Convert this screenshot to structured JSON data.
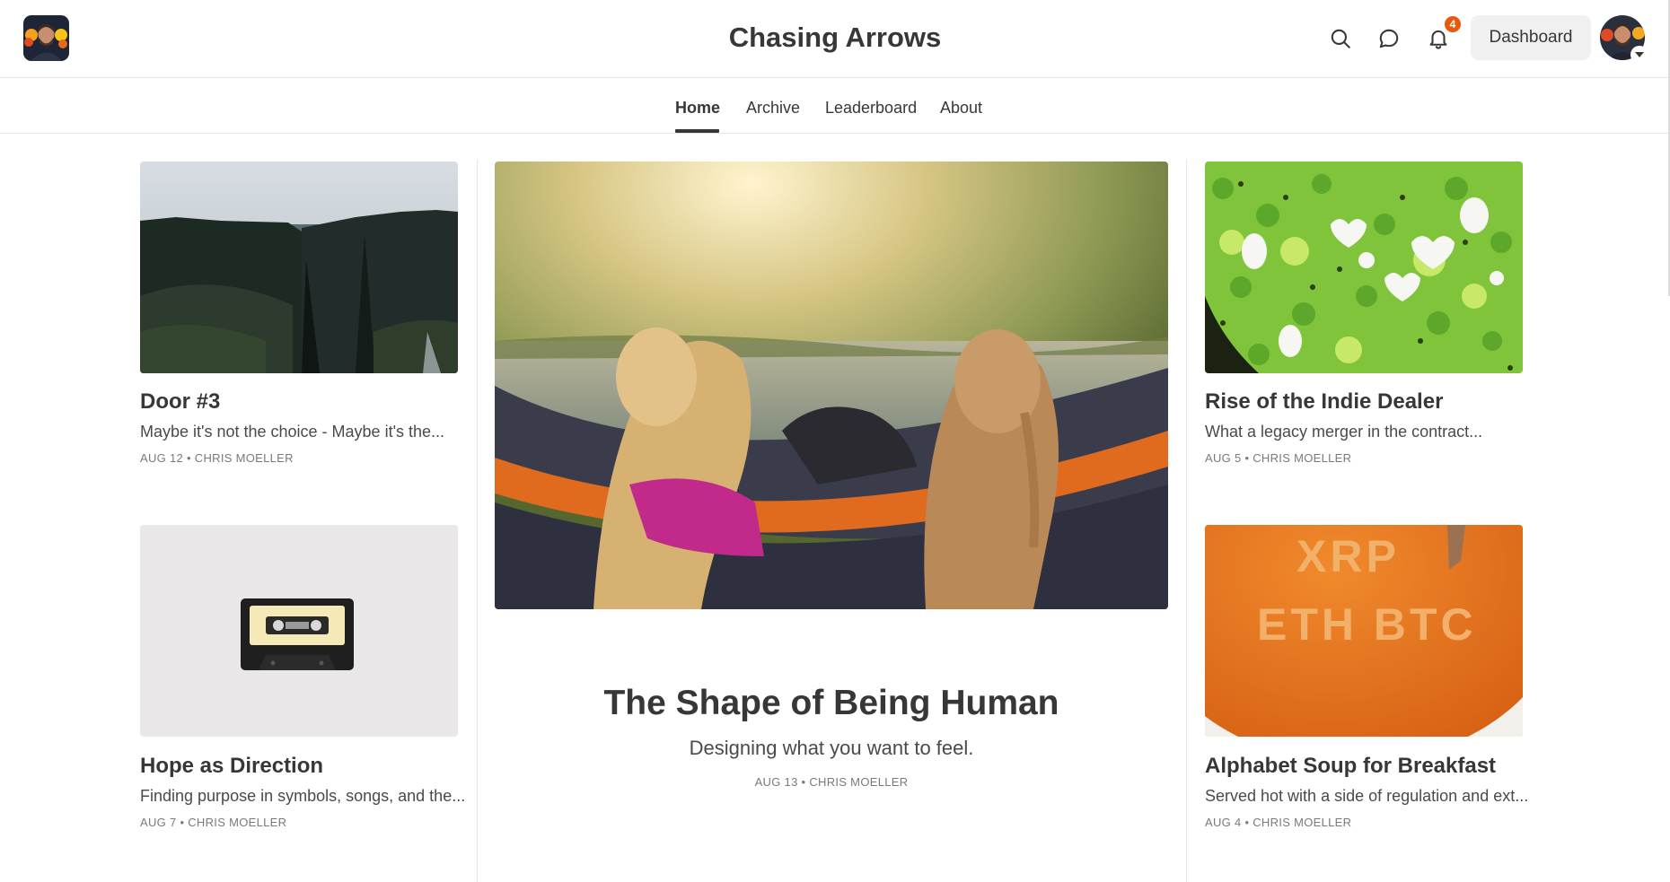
{
  "header": {
    "publication_title": "Chasing Arrows",
    "notification_count": "4",
    "dashboard_label": "Dashboard",
    "icons": [
      "search-icon",
      "chat-bubble-icon",
      "bell-icon",
      "chevron-down-icon"
    ]
  },
  "nav": {
    "items": [
      {
        "label": "Home",
        "active": true
      },
      {
        "label": "Archive",
        "active": false
      },
      {
        "label": "Leaderboard",
        "active": false
      },
      {
        "label": "About",
        "active": false
      }
    ]
  },
  "posts": {
    "featured": {
      "title": "The Shape of Being Human",
      "subtitle": "Designing what you want to feel.",
      "date": "AUG 13",
      "author": "CHRIS MOELLER"
    },
    "left": [
      {
        "title": "Door #3",
        "subtitle": "Maybe it's not the choice - Maybe it's the...",
        "date": "AUG 12",
        "author": "CHRIS MOELLER"
      },
      {
        "title": "Hope as Direction",
        "subtitle": "Finding purpose in symbols, songs, and the...",
        "date": "AUG 7",
        "author": "CHRIS MOELLER"
      }
    ],
    "right": [
      {
        "title": "Rise of the Indie Dealer",
        "subtitle": "What a legacy merger in the contract...",
        "date": "AUG 5",
        "author": "CHRIS MOELLER"
      },
      {
        "title": "Alphabet Soup for Breakfast",
        "subtitle": "Served hot with a side of regulation and ext...",
        "date": "AUG 4",
        "author": "CHRIS MOELLER",
        "image_text": [
          "XRP",
          "ETH BTC"
        ]
      }
    ]
  },
  "meta_separator": "•",
  "colors": {
    "text": "#363737",
    "badge": "#e8590c",
    "divider": "#e6e6e6",
    "button_bg": "#f0f0f0"
  }
}
